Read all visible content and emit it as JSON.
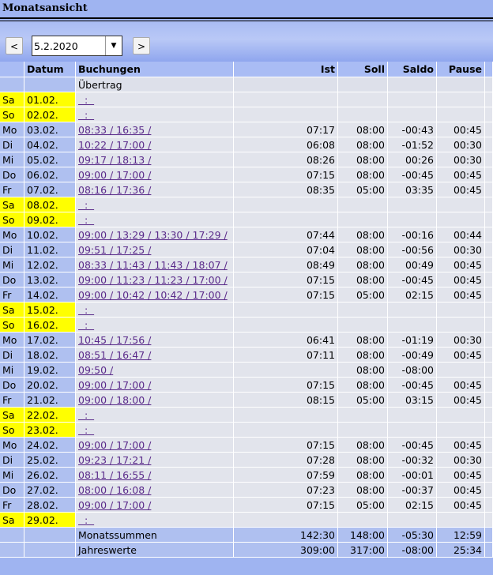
{
  "title": "Monatsansicht",
  "nav": {
    "prev_label": "<",
    "next_label": ">",
    "date_value": "5.2.2020",
    "dropdown_glyph": "▼"
  },
  "table": {
    "headers": [
      "",
      "Datum",
      "Buchungen",
      "Ist",
      "Soll",
      "Saldo",
      "Pause"
    ],
    "carry_label": "Übertrag",
    "rows": [
      {
        "wd": "Sa",
        "date": "01.02.",
        "book": "  :  ",
        "ist": "",
        "soll": "",
        "saldo": "",
        "pause": "",
        "weekend": true
      },
      {
        "wd": "So",
        "date": "02.02.",
        "book": "  :  ",
        "ist": "",
        "soll": "",
        "saldo": "",
        "pause": "",
        "weekend": true
      },
      {
        "wd": "Mo",
        "date": "03.02.",
        "book": "08:33 / 16:35 /",
        "ist": "07:17",
        "soll": "08:00",
        "saldo": "-00:43",
        "pause": "00:45",
        "weekend": false
      },
      {
        "wd": "Di",
        "date": "04.02.",
        "book": "10:22 / 17:00 /",
        "ist": "06:08",
        "soll": "08:00",
        "saldo": "-01:52",
        "pause": "00:30",
        "weekend": false
      },
      {
        "wd": "Mi",
        "date": "05.02.",
        "book": "09:17 / 18:13 /",
        "ist": "08:26",
        "soll": "08:00",
        "saldo": "00:26",
        "pause": "00:30",
        "weekend": false
      },
      {
        "wd": "Do",
        "date": "06.02.",
        "book": "09:00 / 17:00 /",
        "ist": "07:15",
        "soll": "08:00",
        "saldo": "-00:45",
        "pause": "00:45",
        "weekend": false
      },
      {
        "wd": "Fr",
        "date": "07.02.",
        "book": "08:16 / 17:36 /",
        "ist": "08:35",
        "soll": "05:00",
        "saldo": "03:35",
        "pause": "00:45",
        "weekend": false
      },
      {
        "wd": "Sa",
        "date": "08.02.",
        "book": "  :  ",
        "ist": "",
        "soll": "",
        "saldo": "",
        "pause": "",
        "weekend": true
      },
      {
        "wd": "So",
        "date": "09.02.",
        "book": "  :  ",
        "ist": "",
        "soll": "",
        "saldo": "",
        "pause": "",
        "weekend": true
      },
      {
        "wd": "Mo",
        "date": "10.02.",
        "book": "09:00 / 13:29 / 13:30 / 17:29 /",
        "ist": "07:44",
        "soll": "08:00",
        "saldo": "-00:16",
        "pause": "00:44",
        "weekend": false
      },
      {
        "wd": "Di",
        "date": "11.02.",
        "book": "09:51 / 17:25 /",
        "ist": "07:04",
        "soll": "08:00",
        "saldo": "-00:56",
        "pause": "00:30",
        "weekend": false
      },
      {
        "wd": "Mi",
        "date": "12.02.",
        "book": "08:33 / 11:43 / 11:43 / 18:07 /",
        "ist": "08:49",
        "soll": "08:00",
        "saldo": "00:49",
        "pause": "00:45",
        "weekend": false
      },
      {
        "wd": "Do",
        "date": "13.02.",
        "book": "09:00 / 11:23 / 11:23 / 17:00 /",
        "ist": "07:15",
        "soll": "08:00",
        "saldo": "-00:45",
        "pause": "00:45",
        "weekend": false
      },
      {
        "wd": "Fr",
        "date": "14.02.",
        "book": "09:00 / 10:42 / 10:42 / 17:00 /",
        "ist": "07:15",
        "soll": "05:00",
        "saldo": "02:15",
        "pause": "00:45",
        "weekend": false
      },
      {
        "wd": "Sa",
        "date": "15.02.",
        "book": "  :  ",
        "ist": "",
        "soll": "",
        "saldo": "",
        "pause": "",
        "weekend": true
      },
      {
        "wd": "So",
        "date": "16.02.",
        "book": "  :  ",
        "ist": "",
        "soll": "",
        "saldo": "",
        "pause": "",
        "weekend": true
      },
      {
        "wd": "Mo",
        "date": "17.02.",
        "book": "10:45 / 17:56 /",
        "ist": "06:41",
        "soll": "08:00",
        "saldo": "-01:19",
        "pause": "00:30",
        "weekend": false
      },
      {
        "wd": "Di",
        "date": "18.02.",
        "book": "08:51 / 16:47 /",
        "ist": "07:11",
        "soll": "08:00",
        "saldo": "-00:49",
        "pause": "00:45",
        "weekend": false
      },
      {
        "wd": "Mi",
        "date": "19.02.",
        "book": "09:50 /",
        "ist": "",
        "soll": "08:00",
        "saldo": "-08:00",
        "pause": "",
        "weekend": false
      },
      {
        "wd": "Do",
        "date": "20.02.",
        "book": "09:00 / 17:00 /",
        "ist": "07:15",
        "soll": "08:00",
        "saldo": "-00:45",
        "pause": "00:45",
        "weekend": false
      },
      {
        "wd": "Fr",
        "date": "21.02.",
        "book": "09:00 / 18:00 /",
        "ist": "08:15",
        "soll": "05:00",
        "saldo": "03:15",
        "pause": "00:45",
        "weekend": false
      },
      {
        "wd": "Sa",
        "date": "22.02.",
        "book": "  :  ",
        "ist": "",
        "soll": "",
        "saldo": "",
        "pause": "",
        "weekend": true
      },
      {
        "wd": "So",
        "date": "23.02.",
        "book": "  :  ",
        "ist": "",
        "soll": "",
        "saldo": "",
        "pause": "",
        "weekend": true
      },
      {
        "wd": "Mo",
        "date": "24.02.",
        "book": "09:00 / 17:00 /",
        "ist": "07:15",
        "soll": "08:00",
        "saldo": "-00:45",
        "pause": "00:45",
        "weekend": false
      },
      {
        "wd": "Di",
        "date": "25.02.",
        "book": "09:23 / 17:21 /",
        "ist": "07:28",
        "soll": "08:00",
        "saldo": "-00:32",
        "pause": "00:30",
        "weekend": false
      },
      {
        "wd": "Mi",
        "date": "26.02.",
        "book": "08:11 / 16:55 /",
        "ist": "07:59",
        "soll": "08:00",
        "saldo": "-00:01",
        "pause": "00:45",
        "weekend": false
      },
      {
        "wd": "Do",
        "date": "27.02.",
        "book": "08:00 / 16:08 /",
        "ist": "07:23",
        "soll": "08:00",
        "saldo": "-00:37",
        "pause": "00:45",
        "weekend": false
      },
      {
        "wd": "Fr",
        "date": "28.02.",
        "book": "09:00 / 17:00 /",
        "ist": "07:15",
        "soll": "05:00",
        "saldo": "02:15",
        "pause": "00:45",
        "weekend": false
      },
      {
        "wd": "Sa",
        "date": "29.02.",
        "book": "  :  ",
        "ist": "",
        "soll": "",
        "saldo": "",
        "pause": "",
        "weekend": true
      }
    ],
    "totals": [
      {
        "label": "Monatssummen",
        "ist": "142:30",
        "soll": "148:00",
        "saldo": "-05:30",
        "pause": "12:59"
      },
      {
        "label": "Jahreswerte",
        "ist": "309:00",
        "soll": "317:00",
        "saldo": "-08:00",
        "pause": "25:34"
      }
    ]
  },
  "colors": {
    "background": "#9fb4f1",
    "weekend": "#ffff00",
    "cell": "#e2e4ec",
    "link": "#5a2a8a"
  }
}
